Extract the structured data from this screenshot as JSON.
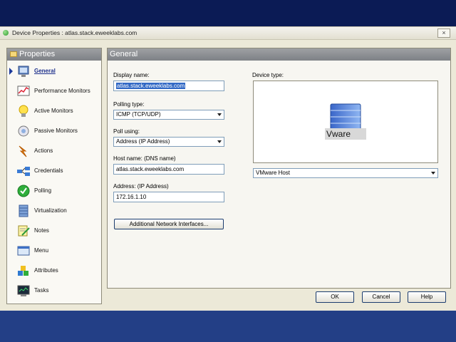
{
  "window": {
    "title": "Device Properties : atlas.stack.eweeklabs.com",
    "close_glyph": "×"
  },
  "sidebar": {
    "header": "Properties",
    "items": [
      {
        "label": "General",
        "icon": "monitor-icon",
        "selected": true
      },
      {
        "label": "Performance Monitors",
        "icon": "performance-chart-icon"
      },
      {
        "label": "Active Monitors",
        "icon": "lightbulb-icon"
      },
      {
        "label": "Passive Monitors",
        "icon": "passive-monitor-icon"
      },
      {
        "label": "Actions",
        "icon": "actions-icon"
      },
      {
        "label": "Credentials",
        "icon": "credentials-icon"
      },
      {
        "label": "Polling",
        "icon": "checkmark-icon"
      },
      {
        "label": "Virtualization",
        "icon": "server-stack-icon"
      },
      {
        "label": "Notes",
        "icon": "notepad-icon"
      },
      {
        "label": "Menu",
        "icon": "menu-window-icon"
      },
      {
        "label": "Attributes",
        "icon": "blocks-icon"
      },
      {
        "label": "Tasks",
        "icon": "terminal-icon"
      }
    ]
  },
  "main": {
    "header": "General",
    "display_name": {
      "label": "Display name:",
      "value": "atlas.stack.eweeklabs.com"
    },
    "polling_type": {
      "label": "Polling type:",
      "value": "ICMP  (TCP/UDP)"
    },
    "poll_using": {
      "label": "Poll using:",
      "value": "Address  (IP Address)"
    },
    "host_name": {
      "label": "Host name: (DNS name)",
      "value": "atlas.stack.eweeklabs.com"
    },
    "address": {
      "label": "Address: (IP Address)",
      "value": "172.16.1.10"
    },
    "additional_button": "Additional Network Interfaces...",
    "device_type": {
      "label": "Device type:",
      "image_text": "Vware",
      "value": "VMware Host"
    }
  },
  "buttons": {
    "ok": "OK",
    "cancel": "Cancel",
    "help": "Help"
  },
  "colors": {
    "desktop_top": "#0b1b55",
    "desktop_bottom": "#233f86",
    "selection": "#3168c5",
    "accent": "#1c2f8c"
  }
}
